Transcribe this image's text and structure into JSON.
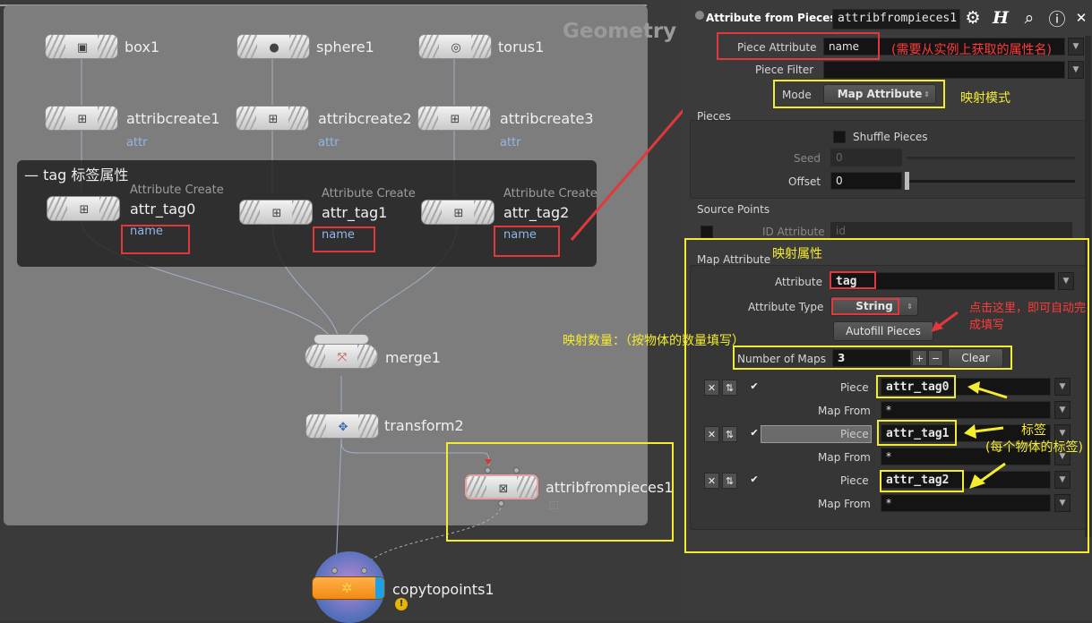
{
  "network": {
    "context_label": "Geometry",
    "nodes": {
      "box1": "box1",
      "sphere1": "sphere1",
      "torus1": "torus1",
      "attribcreate1": "attribcreate1",
      "attribcreate2": "attribcreate2",
      "attribcreate3": "attribcreate3",
      "attr_sub": "attr",
      "attr_tag0": "attr_tag0",
      "attr_tag1": "attr_tag1",
      "attr_tag2": "attr_tag2",
      "attr_create_type": "Attribute Create",
      "name_sub": "name",
      "merge1": "merge1",
      "transform2": "transform2",
      "attribfrompieces1": "attribfrompieces1",
      "copytopoints1": "copytopoints1"
    },
    "netbox_title": "— tag 标签属性"
  },
  "annotations": {
    "piece_attr_note": "(需要从实例上获取的属性名)",
    "mode_note": "映射模式",
    "map_attr_note": "映射属性",
    "autofill_note_1": "点击这里，即可自动完",
    "autofill_note_2": "成填写",
    "num_maps_note": "映射数量：（按物体的数量填写）",
    "tag_note_1": "标签",
    "tag_note_2": "(每个物体的标签)"
  },
  "params": {
    "node_type": "Attribute from Pieces",
    "node_name": "attribfrompieces1",
    "piece_attribute_label": "Piece Attribute",
    "piece_attribute_value": "name",
    "piece_filter_label": "Piece Filter",
    "piece_filter_value": "",
    "mode_label": "Mode",
    "mode_value": "Map Attribute",
    "pieces_title": "Pieces",
    "shuffle_label": "Shuffle Pieces",
    "seed_label": "Seed",
    "seed_value": "0",
    "offset_label": "Offset",
    "offset_value": "0",
    "source_points_title": "Source Points",
    "id_attr_label": "ID Attribute",
    "id_attr_value": "id",
    "map_attribute_title": "Map Attribute",
    "attribute_label": "Attribute",
    "attribute_value": "tag",
    "attribute_type_label": "Attribute Type",
    "attribute_type_value": "String",
    "autofill_label": "Autofill Pieces",
    "num_maps_label": "Number of Maps",
    "num_maps_value": "3",
    "plus": "+",
    "minus": "−",
    "clear_label": "Clear",
    "piece_label": "Piece",
    "map_from_label": "Map From",
    "maps": [
      {
        "piece": "attr_tag0",
        "map_from": "*"
      },
      {
        "piece": "attr_tag1",
        "map_from": "*"
      },
      {
        "piece": "attr_tag2",
        "map_from": "*"
      }
    ]
  },
  "icons": [
    "gear-icon",
    "help-h-icon",
    "search-icon",
    "info-icon",
    "close-icon"
  ],
  "colors": {
    "annotation_red": "#e0393c",
    "annotation_yellow": "#f4ec2f",
    "selected_node": "#e8a0a0",
    "attr_blue": "#8fb7e8"
  }
}
